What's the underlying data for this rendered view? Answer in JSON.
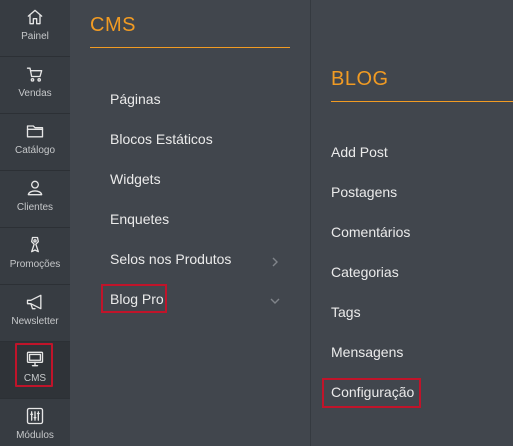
{
  "rail": {
    "items": [
      {
        "label": "Painel",
        "icon": "home-icon"
      },
      {
        "label": "Vendas",
        "icon": "cart-icon"
      },
      {
        "label": "Catálogo",
        "icon": "folder-icon"
      },
      {
        "label": "Clientes",
        "icon": "user-icon"
      },
      {
        "label": "Promoções",
        "icon": "tag-icon"
      },
      {
        "label": "Newsletter",
        "icon": "megaphone-icon"
      },
      {
        "label": "CMS",
        "icon": "monitor-icon"
      },
      {
        "label": "Módulos",
        "icon": "sliders-icon"
      }
    ]
  },
  "cms": {
    "title": "CMS",
    "items": [
      {
        "label": "Páginas"
      },
      {
        "label": "Blocos Estáticos"
      },
      {
        "label": "Widgets"
      },
      {
        "label": "Enquetes"
      },
      {
        "label": "Selos nos Produtos"
      },
      {
        "label": "Blog Pro"
      }
    ]
  },
  "blog": {
    "title": "BLOG",
    "items": [
      {
        "label": "Add Post"
      },
      {
        "label": "Postagens"
      },
      {
        "label": "Comentários"
      },
      {
        "label": "Categorias"
      },
      {
        "label": "Tags"
      },
      {
        "label": "Mensagens"
      },
      {
        "label": "Configuração"
      }
    ]
  },
  "colors": {
    "accent": "#f19b23",
    "highlight": "#c0142a",
    "rail_bg": "#373c42",
    "panel_bg": "#41464d"
  }
}
